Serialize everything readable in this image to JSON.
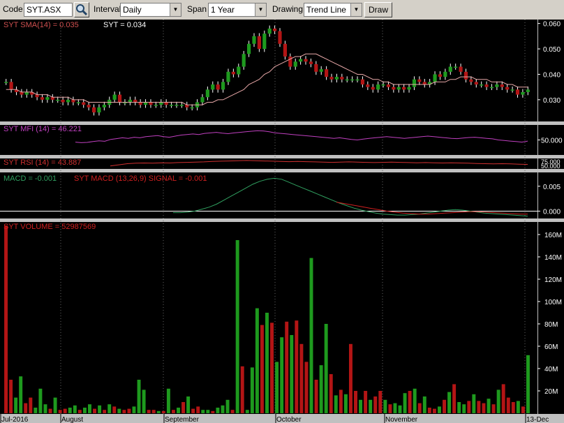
{
  "toolbar": {
    "code_label": "Code",
    "code_value": "SYT.ASX",
    "interval_label": "Interval",
    "interval_value": "Daily",
    "span_label": "Span",
    "span_value": "1 Year",
    "drawing_label": "Drawing",
    "drawing_value": "Trend Line",
    "draw_button": "Draw"
  },
  "panels": {
    "price_sma_label": "SYT SMA(14) = 0.035",
    "price_label": "SYT = 0.034",
    "mfi_label": "SYT MFI (14) = 46.221",
    "rsi_label": "SYT RSI (14) = 43.887",
    "macd_label": "MACD = -0.001",
    "macd_signal_label": "SYT MACD (13,26,9) SIGNAL = -0.001",
    "volume_label": "SYT VOLUME = 52987569"
  },
  "colors": {
    "up": "#1e9a1e",
    "down": "#b31515",
    "sma": "#e8a8a8",
    "mfi": "#c040c0",
    "rsi": "#d03030",
    "macd": "#30a060",
    "signal": "#d02020",
    "axis_text": "#ffffff"
  },
  "chart_data": [
    {
      "type": "candlestick",
      "title": "SYT",
      "x_labels": [
        "Jul-2016",
        "August",
        "September",
        "October",
        "November",
        "13-Dec"
      ],
      "y_ticks": [
        "0.060",
        "0.050",
        "0.040",
        "0.030"
      ],
      "ylim": [
        0.022,
        0.061
      ],
      "close": [
        0.037,
        0.034,
        0.033,
        0.032,
        0.033,
        0.032,
        0.031,
        0.03,
        0.031,
        0.03,
        0.03,
        0.029,
        0.03,
        0.029,
        0.029,
        0.028,
        0.027,
        0.025,
        0.027,
        0.028,
        0.03,
        0.032,
        0.029,
        0.029,
        0.03,
        0.029,
        0.028,
        0.029,
        0.028,
        0.028,
        0.029,
        0.028,
        0.028,
        0.028,
        0.028,
        0.027,
        0.027,
        0.029,
        0.031,
        0.034,
        0.036,
        0.034,
        0.037,
        0.041,
        0.04,
        0.043,
        0.048,
        0.052,
        0.055,
        0.05,
        0.056,
        0.058,
        0.057,
        0.052,
        0.047,
        0.043,
        0.045,
        0.046,
        0.045,
        0.044,
        0.041,
        0.042,
        0.039,
        0.038,
        0.039,
        0.038,
        0.038,
        0.038,
        0.038,
        0.036,
        0.035,
        0.034,
        0.036,
        0.036,
        0.035,
        0.034,
        0.035,
        0.034,
        0.035,
        0.038,
        0.037,
        0.036,
        0.037,
        0.04,
        0.039,
        0.041,
        0.043,
        0.043,
        0.041,
        0.038,
        0.037,
        0.036,
        0.036,
        0.035,
        0.035,
        0.036,
        0.035,
        0.034,
        0.034,
        0.032,
        0.033,
        0.034
      ],
      "sma": [
        0.034,
        0.034,
        0.034,
        0.033,
        0.033,
        0.033,
        0.032,
        0.032,
        0.032,
        0.031,
        0.031,
        0.031,
        0.031,
        0.03,
        0.03,
        0.03,
        0.029,
        0.029,
        0.029,
        0.029,
        0.029,
        0.029,
        0.029,
        0.029,
        0.029,
        0.029,
        0.029,
        0.029,
        0.029,
        0.029,
        0.029,
        0.029,
        0.029,
        0.029,
        0.029,
        0.028,
        0.028,
        0.028,
        0.028,
        0.029,
        0.029,
        0.03,
        0.03,
        0.031,
        0.032,
        0.033,
        0.034,
        0.036,
        0.037,
        0.038,
        0.04,
        0.041,
        0.043,
        0.044,
        0.045,
        0.046,
        0.047,
        0.047,
        0.048,
        0.048,
        0.048,
        0.047,
        0.046,
        0.045,
        0.044,
        0.043,
        0.042,
        0.041,
        0.04,
        0.04,
        0.039,
        0.038,
        0.038,
        0.037,
        0.037,
        0.036,
        0.036,
        0.036,
        0.036,
        0.036,
        0.036,
        0.036,
        0.036,
        0.037,
        0.037,
        0.037,
        0.038,
        0.038,
        0.039,
        0.039,
        0.039,
        0.038,
        0.038,
        0.038,
        0.037,
        0.037,
        0.037,
        0.036,
        0.036,
        0.035,
        0.035,
        0.035
      ]
    },
    {
      "type": "line",
      "title": "SYT MFI (14)",
      "y_ticks": [
        "50.000"
      ],
      "ylim": [
        0,
        100
      ],
      "values": [
        42,
        40,
        41,
        44,
        47,
        45,
        52,
        55,
        58,
        56,
        60,
        58,
        62,
        64,
        66,
        62,
        60,
        64,
        68,
        70,
        72,
        70,
        74,
        76,
        78,
        75,
        73,
        76,
        78,
        80,
        82,
        84,
        83,
        80,
        76,
        74,
        72,
        70,
        68,
        66,
        64,
        62,
        60,
        58,
        56,
        58,
        55,
        52,
        50,
        53,
        56,
        58,
        60,
        62,
        60,
        58,
        56,
        58,
        60,
        62,
        64,
        62,
        60,
        58,
        56,
        55,
        57,
        59,
        60,
        58,
        56,
        54,
        50,
        48,
        46,
        44,
        42,
        46
      ]
    },
    {
      "type": "line",
      "title": "SYT RSI (14)",
      "y_ticks": [
        "75.000",
        "50.000"
      ],
      "ylim": [
        40,
        80
      ],
      "values": [
        50,
        55,
        60,
        62,
        63,
        62,
        64,
        63,
        65,
        66,
        67,
        68,
        70,
        71,
        72,
        73,
        74,
        73,
        72,
        71,
        70,
        69,
        70,
        69,
        68,
        67,
        66,
        67,
        68,
        67,
        66,
        65,
        66,
        67,
        66,
        65,
        64,
        65,
        64,
        63,
        64,
        63,
        62,
        61,
        60,
        59,
        60,
        59,
        58,
        57
      ]
    },
    {
      "type": "line",
      "title": "SYT MACD (13,26,9)",
      "y_ticks": [
        "0.005",
        "0.000"
      ],
      "ylim": [
        -0.0012,
        0.0075
      ],
      "macd": [
        -0.0003,
        -0.0003,
        -0.0002,
        0.0,
        0.0004,
        0.0008,
        0.0014,
        0.0022,
        0.003,
        0.0038,
        0.0046,
        0.0054,
        0.006,
        0.0064,
        0.0066,
        0.0064,
        0.0058,
        0.0052,
        0.0046,
        0.004,
        0.0034,
        0.0028,
        0.0022,
        0.0016,
        0.0011,
        0.0006,
        0.0002,
        -0.0001,
        -0.0004,
        -0.0006,
        -0.0007,
        -0.0008,
        -0.0008,
        -0.0007,
        -0.0006,
        -0.0004,
        -0.0002,
        0.0,
        0.0002,
        0.0003,
        0.0002,
        0.0,
        -0.0002,
        -0.0004,
        -0.0005,
        -0.0006,
        -0.0007,
        -0.0008,
        -0.0009,
        -0.001
      ],
      "signal": [
        0.0018,
        0.0015,
        0.0012,
        0.0009,
        0.0006,
        0.0003,
        0.0,
        -0.0002,
        -0.0004,
        -0.0005,
        -0.0006,
        -0.0006,
        -0.0005,
        -0.0004,
        -0.0003,
        -0.0002,
        -0.0001,
        -0.0001,
        -0.0002,
        -0.0003,
        -0.0004,
        -0.0005,
        -0.0006,
        -0.0006
      ]
    },
    {
      "type": "bar",
      "title": "SYT VOLUME",
      "y_ticks": [
        "160M",
        "140M",
        "120M",
        "100M",
        "80M",
        "60M",
        "40M",
        "20M"
      ],
      "ylim": [
        0,
        170
      ],
      "values": [
        168,
        30,
        14,
        33,
        9,
        14,
        5,
        22,
        8,
        4,
        14,
        3,
        4,
        5,
        7,
        3,
        5,
        8,
        4,
        7,
        3,
        8,
        6,
        4,
        3,
        4,
        6,
        30,
        21,
        3,
        3,
        2,
        2,
        22,
        3,
        5,
        10,
        15,
        4,
        6,
        3,
        3,
        2,
        5,
        7,
        12,
        3,
        155,
        42,
        3,
        41,
        94,
        79,
        90,
        81,
        46,
        68,
        82,
        70,
        83,
        62,
        46,
        139,
        30,
        43,
        80,
        35,
        16,
        21,
        17,
        62,
        20,
        12,
        20,
        12,
        15,
        20,
        12,
        8,
        9,
        7,
        18,
        20,
        22,
        9,
        15,
        5,
        4,
        6,
        12,
        19,
        26,
        10,
        8,
        11,
        17,
        11,
        9,
        13,
        8,
        21,
        26,
        14,
        10,
        11,
        6,
        52
      ],
      "up": [
        false,
        false,
        true,
        true,
        false,
        false,
        true,
        true,
        true,
        false,
        true,
        false,
        false,
        true,
        true,
        false,
        true,
        true,
        false,
        true,
        false,
        true,
        false,
        true,
        false,
        false,
        true,
        true,
        true,
        false,
        false,
        true,
        false,
        true,
        false,
        true,
        false,
        true,
        false,
        false,
        true,
        true,
        false,
        true,
        true,
        true,
        false,
        true,
        false,
        true,
        true,
        true,
        false,
        true,
        false,
        true,
        true,
        false,
        true,
        false,
        false,
        false,
        true,
        false,
        true,
        true,
        false,
        true,
        false,
        true,
        false,
        false,
        true,
        false,
        true,
        false,
        false,
        true,
        false,
        true,
        true,
        true,
        false,
        true,
        false,
        true,
        false,
        false,
        true,
        false,
        true,
        false,
        true,
        true,
        false,
        true,
        false,
        false,
        true,
        false,
        true,
        false,
        false,
        false,
        true,
        false,
        true
      ]
    }
  ]
}
